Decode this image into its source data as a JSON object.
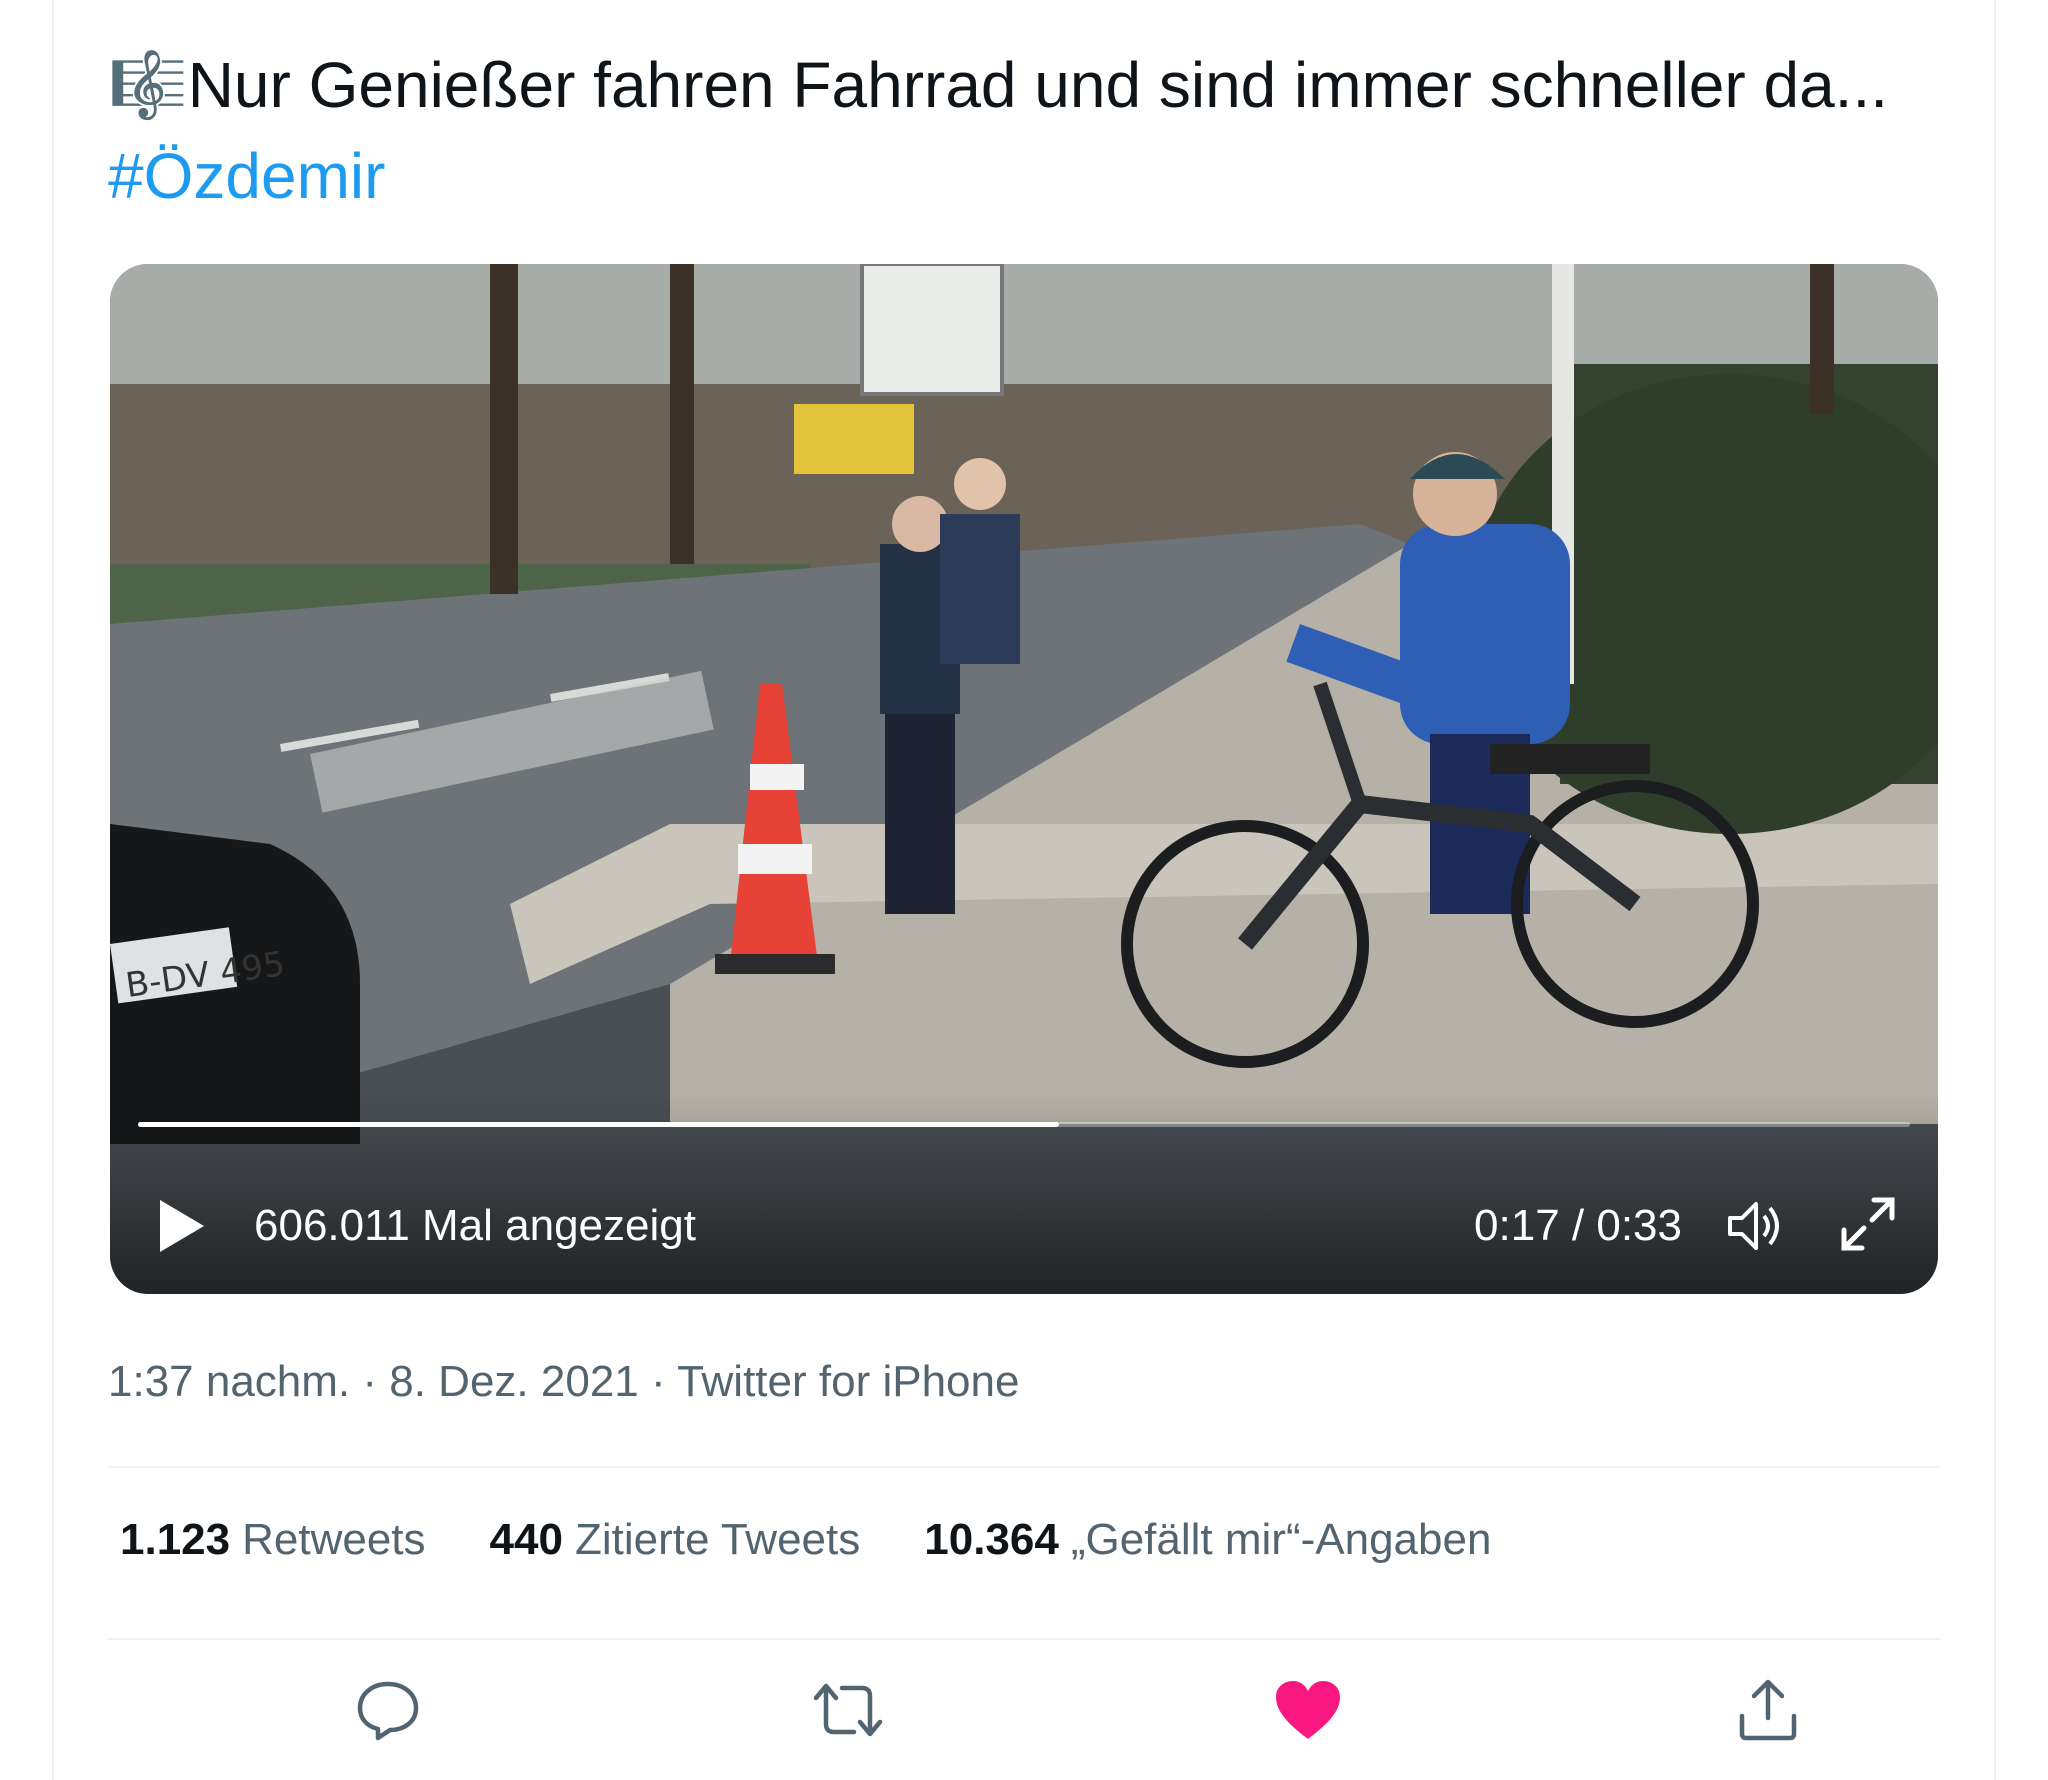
{
  "tweet": {
    "emoji": "🎼",
    "text": "Nur Genießer fahren Fahrrad und sind immer schneller da... ",
    "hashtag": "#Özdemir"
  },
  "video": {
    "views": "606.011 Mal angezeigt",
    "time": "0:17 / 0:33",
    "progress": 0.52,
    "plate": "B-DV 495"
  },
  "meta": {
    "time": "1:37 nachm.",
    "sep1": " · ",
    "date": "8. Dez. 2021",
    "sep2": " · ",
    "source": "Twitter for iPhone"
  },
  "stats": {
    "retweets_count": "1.123",
    "retweets_label": "Retweets",
    "quotes_count": "440",
    "quotes_label": "Zitierte Tweets",
    "likes_count": "10.364",
    "likes_label": "„Gefällt mir“-Angaben"
  },
  "actions": {
    "icons": [
      "reply-icon",
      "retweet-icon",
      "like-icon",
      "share-icon"
    ],
    "like_color": "#f91880",
    "icon_color": "#536471"
  }
}
